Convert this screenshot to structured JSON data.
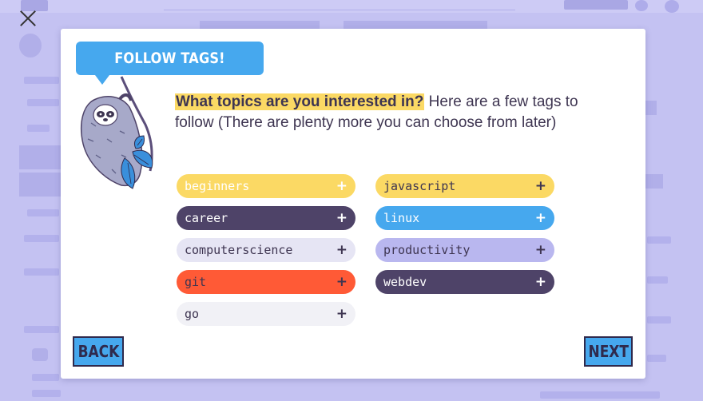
{
  "modal": {
    "title": "FOLLOW TAGS!",
    "question_highlight": "What topics are you interested in?",
    "question_rest": " Here are a few tags to follow (There are plenty more you can choose from later)",
    "back_label": "BACK",
    "next_label": "NEXT"
  },
  "tags": [
    {
      "name": "beginners",
      "bg": "#fbd964",
      "fg": "#ffffff"
    },
    {
      "name": "javascript",
      "bg": "#fbd964",
      "fg": "#3e3551"
    },
    {
      "name": "career",
      "bg": "#4e4368",
      "fg": "#ffffff"
    },
    {
      "name": "linux",
      "bg": "#46a8ee",
      "fg": "#ffffff"
    },
    {
      "name": "computerscience",
      "bg": "#e6e5f4",
      "fg": "#3e3551"
    },
    {
      "name": "productivity",
      "bg": "#b9b7ef",
      "fg": "#3e3551"
    },
    {
      "name": "git",
      "bg": "#ff5a36",
      "fg": "#3e3551"
    },
    {
      "name": "webdev",
      "bg": "#4e4368",
      "fg": "#ffffff"
    },
    {
      "name": "go",
      "bg": "#f1f1f6",
      "fg": "#3e3551"
    }
  ],
  "plus_glyph": "+",
  "icons": {
    "close": "close-icon",
    "mascot": "sloth-mascot-icon"
  },
  "colors": {
    "overlay": "#b9b7ef",
    "accent": "#46a8ee",
    "highlight": "#fbd964",
    "text": "#3e3551"
  }
}
